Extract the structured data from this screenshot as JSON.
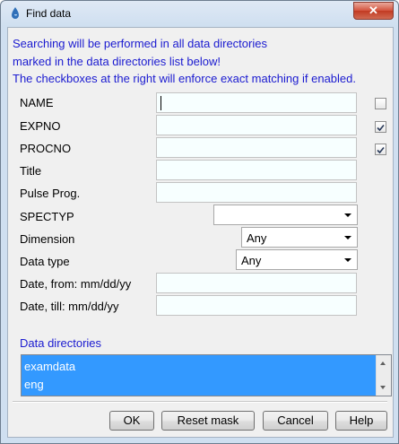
{
  "window": {
    "title": "Find data",
    "close_symbol": "✕"
  },
  "info_lines": [
    "Searching will be performed in all data directories",
    "marked in the data directories list below!",
    "The checkboxes at the right will enforce exact matching if enabled."
  ],
  "fields": {
    "name": {
      "label": "NAME",
      "value": "",
      "exact": false
    },
    "expno": {
      "label": "EXPNO",
      "value": "",
      "exact": true
    },
    "procno": {
      "label": "PROCNO",
      "value": "",
      "exact": true
    },
    "title": {
      "label": "Title",
      "value": ""
    },
    "pulse_prog": {
      "label": "Pulse Prog.",
      "value": ""
    },
    "spectyp": {
      "label": "SPECTYP",
      "value": ""
    },
    "dimension": {
      "label": "Dimension",
      "value": "Any"
    },
    "data_type": {
      "label": "Data type",
      "value": "Any"
    },
    "date_from": {
      "label": "Date, from: mm/dd/yy",
      "value": ""
    },
    "date_till": {
      "label": "Date, till: mm/dd/yy",
      "value": ""
    }
  },
  "data_directories": {
    "label": "Data directories",
    "items": [
      "examdata",
      "eng"
    ]
  },
  "buttons": {
    "ok": "OK",
    "reset": "Reset mask",
    "cancel": "Cancel",
    "help": "Help"
  },
  "check_mark": "✓"
}
